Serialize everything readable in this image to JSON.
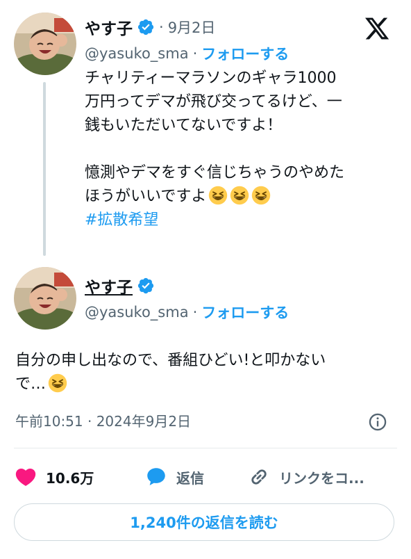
{
  "brand": {
    "x_logo": "x-logo-icon",
    "accent": "#1d9bf0",
    "like_color": "#f91880"
  },
  "original_tweet": {
    "display_name": "やす子",
    "date": "9月2日",
    "handle": "@yasuko_sma",
    "follow_label": "フォローする",
    "lines": [
      "チャリティーマラソンのギャラ1000",
      "万円ってデマが飛び交ってるけど、一",
      "銭もいただいてないですよ！",
      "",
      "憶測やデマをすぐ信じちゃうのやめた",
      "ほうがいいですよ"
    ],
    "emojis": [
      "grinning-squinting-face",
      "grinning-squinting-face",
      "grinning-squinting-face"
    ],
    "hashtag": "#拡散希望"
  },
  "reply_tweet": {
    "display_name": "やす子",
    "handle": "@yasuko_sma",
    "follow_label": "フォローする",
    "lines": [
      "自分の申し出なので、番組ひどい!と叩かない",
      "で…"
    ],
    "emoji": "grinning-squinting-face",
    "timestamp": "午前10:51 · 2024年9月2日"
  },
  "actions": {
    "likes": "10.6万",
    "reply_label": "返信",
    "copy_link_label": "リンクをコ..."
  },
  "read_replies_label": "1,240件の返信を読む"
}
